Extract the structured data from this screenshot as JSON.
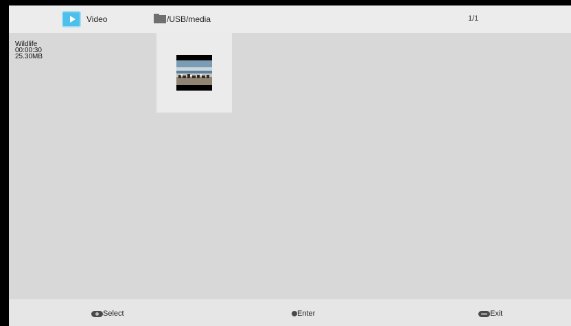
{
  "header": {
    "category_label": "Video",
    "category_icon": "video-play-icon",
    "path_icon": "folder-icon",
    "path": "/USB/media",
    "page_counter": "1/1"
  },
  "selected_file": {
    "name": "Wildlife",
    "duration": "00:00:30",
    "size": "25.30MB"
  },
  "grid": {
    "items": [
      {
        "thumbnail": "video-thumbnail-birds-on-beach"
      }
    ]
  },
  "footer": {
    "select_label": "Select",
    "enter_label": "Enter",
    "exit_label": "Exit",
    "select_icon": "dpad-icon",
    "enter_icon": "ok-button-icon",
    "exit_icon": "exit-button-icon"
  },
  "colors": {
    "accent": "#4cc0ea",
    "background": "#d8d8d8",
    "bar": "#ececec"
  }
}
